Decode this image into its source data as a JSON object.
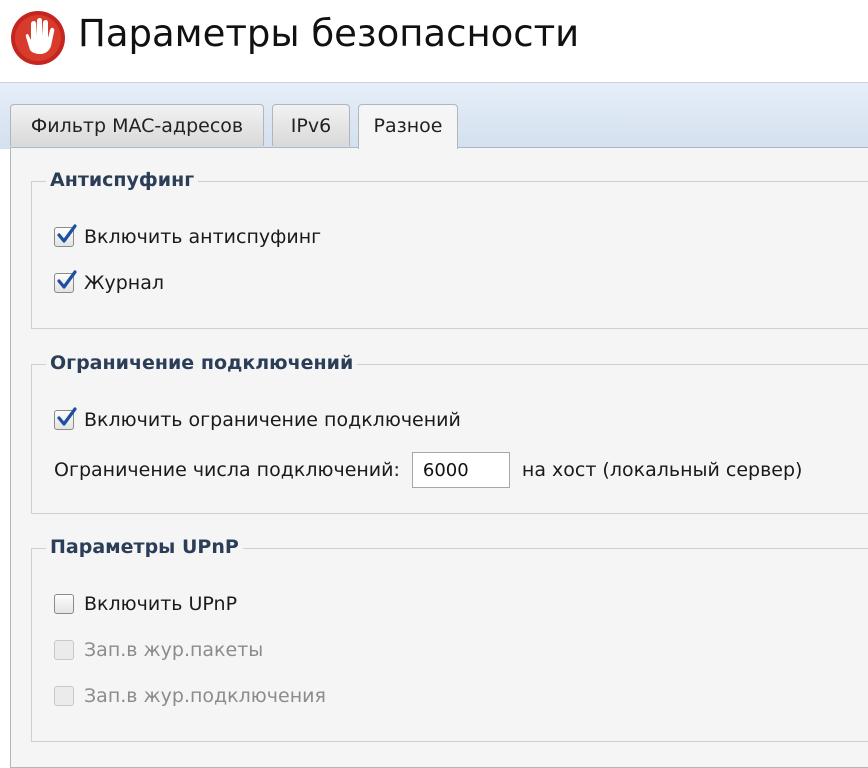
{
  "header": {
    "title": "Параметры безопасности",
    "logo_icon": "stop-hand-icon",
    "logo_color": "#c4251f"
  },
  "tabs": [
    {
      "label": "Фильтр MAC-адресов",
      "active": false
    },
    {
      "label": "IPv6",
      "active": false
    },
    {
      "label": "Разное",
      "active": true
    }
  ],
  "antispoofing": {
    "legend": "Антиспуфинг",
    "enable_label": "Включить антиспуфинг",
    "enable_checked": true,
    "log_label": "Журнал",
    "log_checked": true
  },
  "connection_limit": {
    "legend": "Ограничение подключений",
    "enable_label": "Включить ограничение подключений",
    "enable_checked": true,
    "limit_label": "Ограничение числа подключений:",
    "limit_value": "6000",
    "limit_suffix": "на хост (локальный сервер)"
  },
  "upnp": {
    "legend": "Параметры UPnP",
    "enable_label": "Включить UPnP",
    "enable_checked": false,
    "log_packets_label": "Зап.в жур.пакеты",
    "log_connections_label": "Зап.в жур.подключения"
  },
  "colors": {
    "accent_legend": "#2b3d57",
    "check_blue": "#1d4fa0",
    "tab_band": "#d4e0ef"
  }
}
